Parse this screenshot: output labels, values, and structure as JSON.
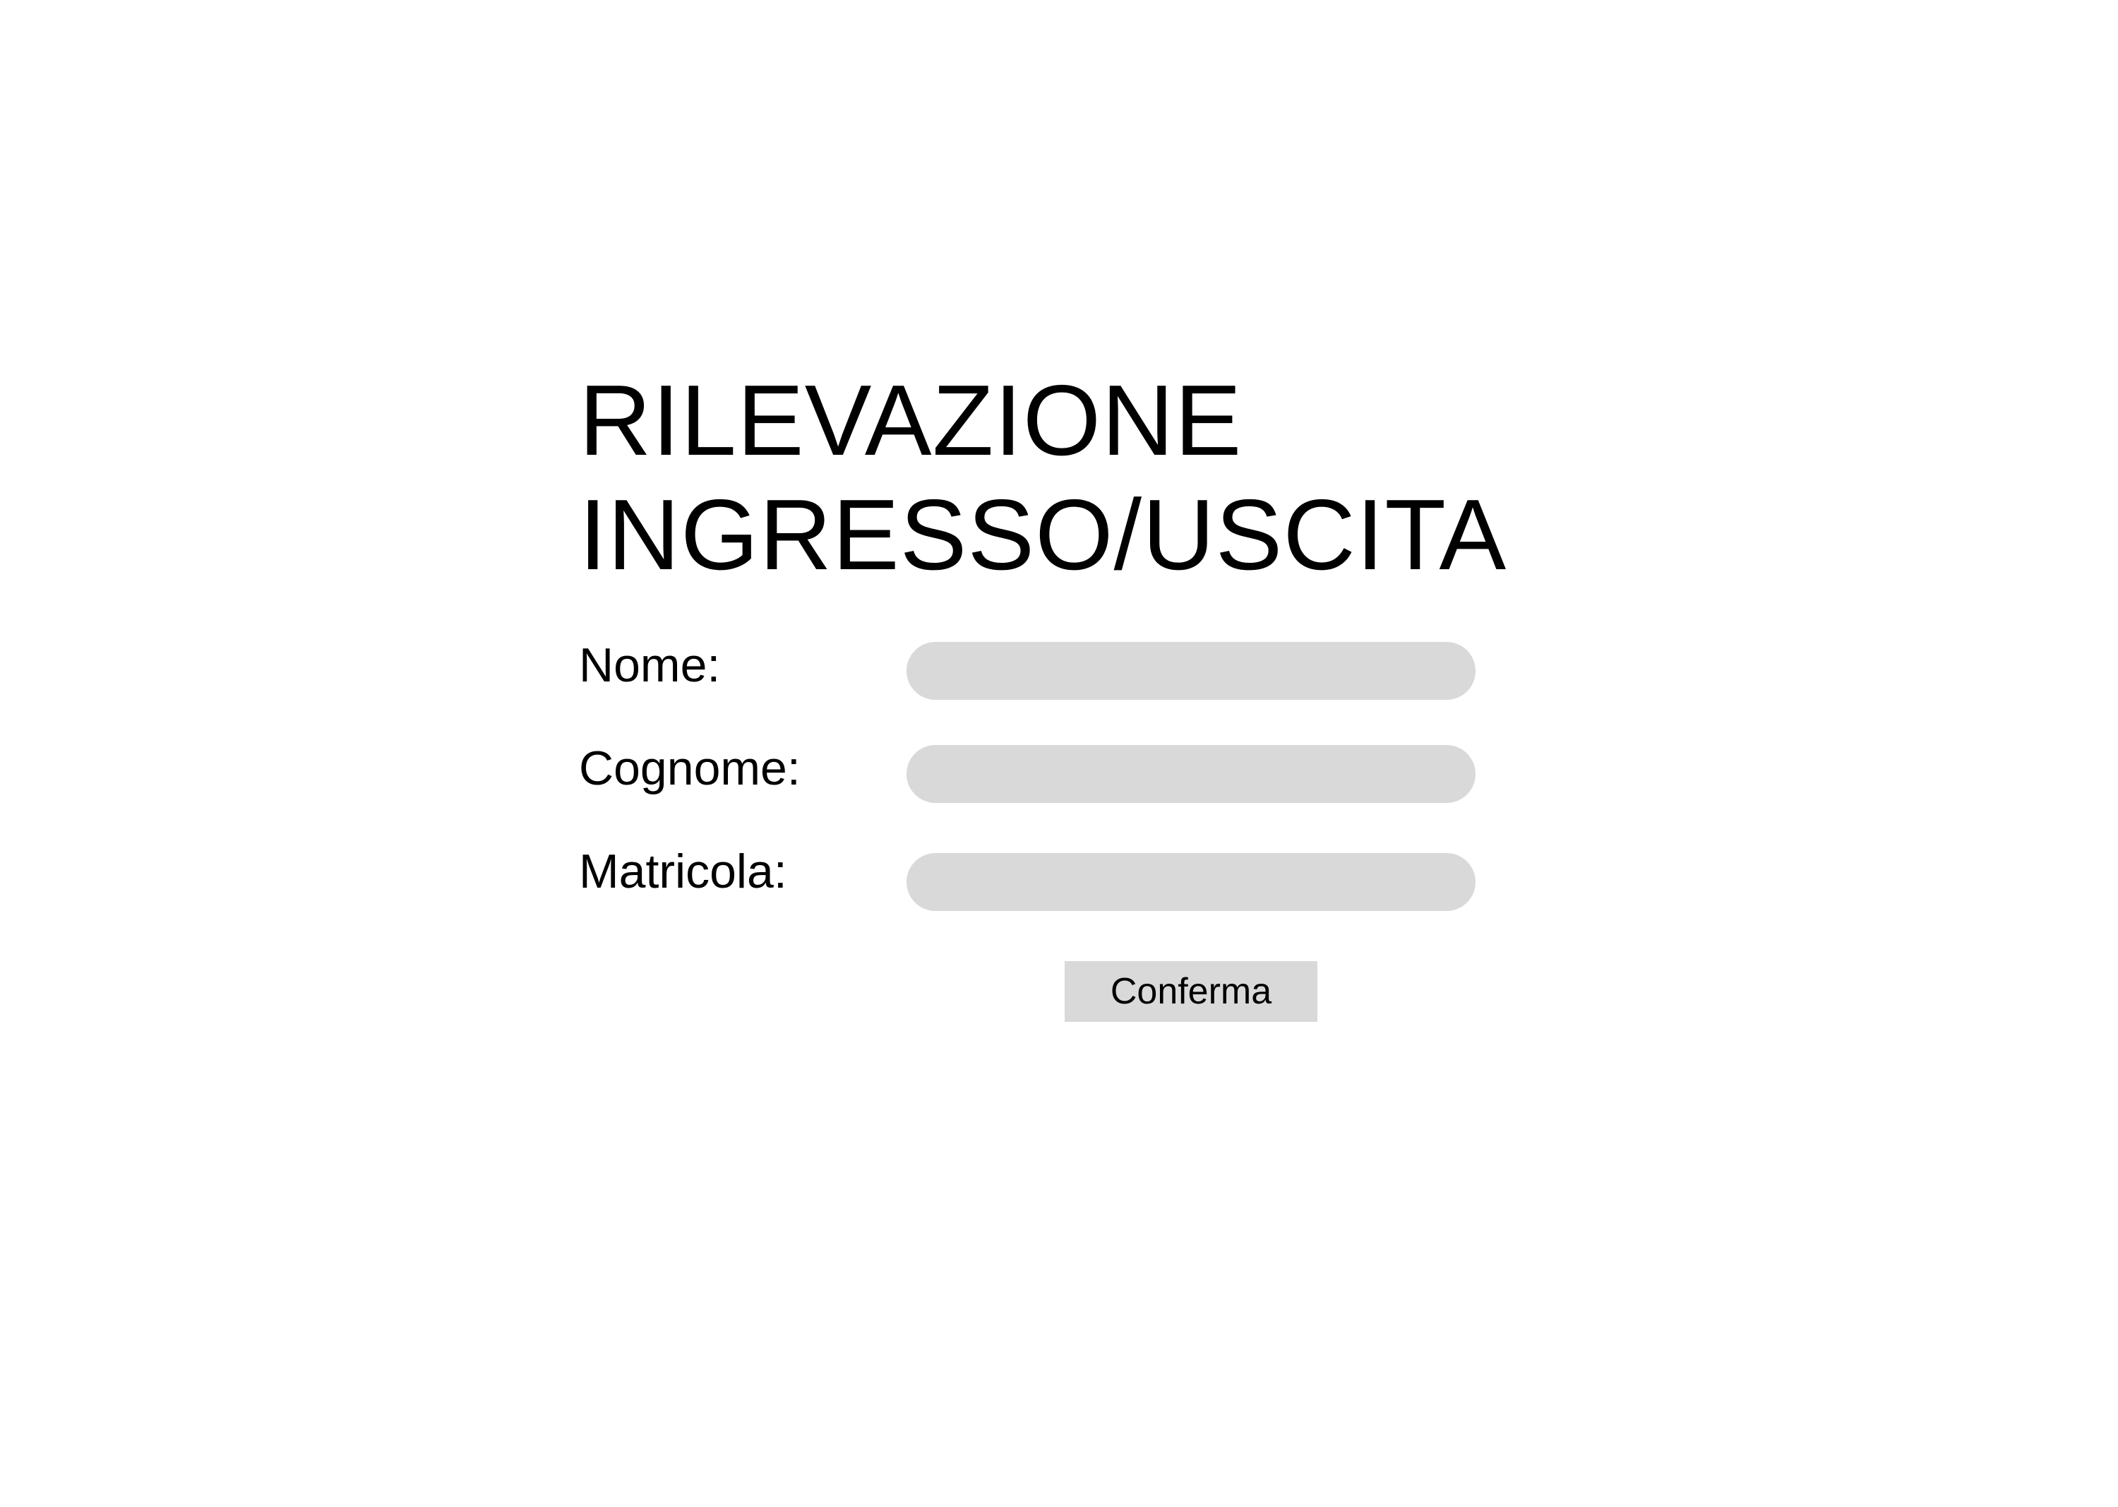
{
  "form": {
    "title_line1": "RILEVAZIONE",
    "title_line2": "INGRESSO/USCITA",
    "fields": [
      {
        "label": "Nome:",
        "value": ""
      },
      {
        "label": "Cognome:",
        "value": ""
      },
      {
        "label": "Matricola:",
        "value": ""
      }
    ],
    "confirm_label": "Conferma"
  },
  "colors": {
    "background": "#ffffff",
    "input_fill": "#d9d9d9",
    "button_fill": "#d9d9d9",
    "text": "#000000"
  }
}
